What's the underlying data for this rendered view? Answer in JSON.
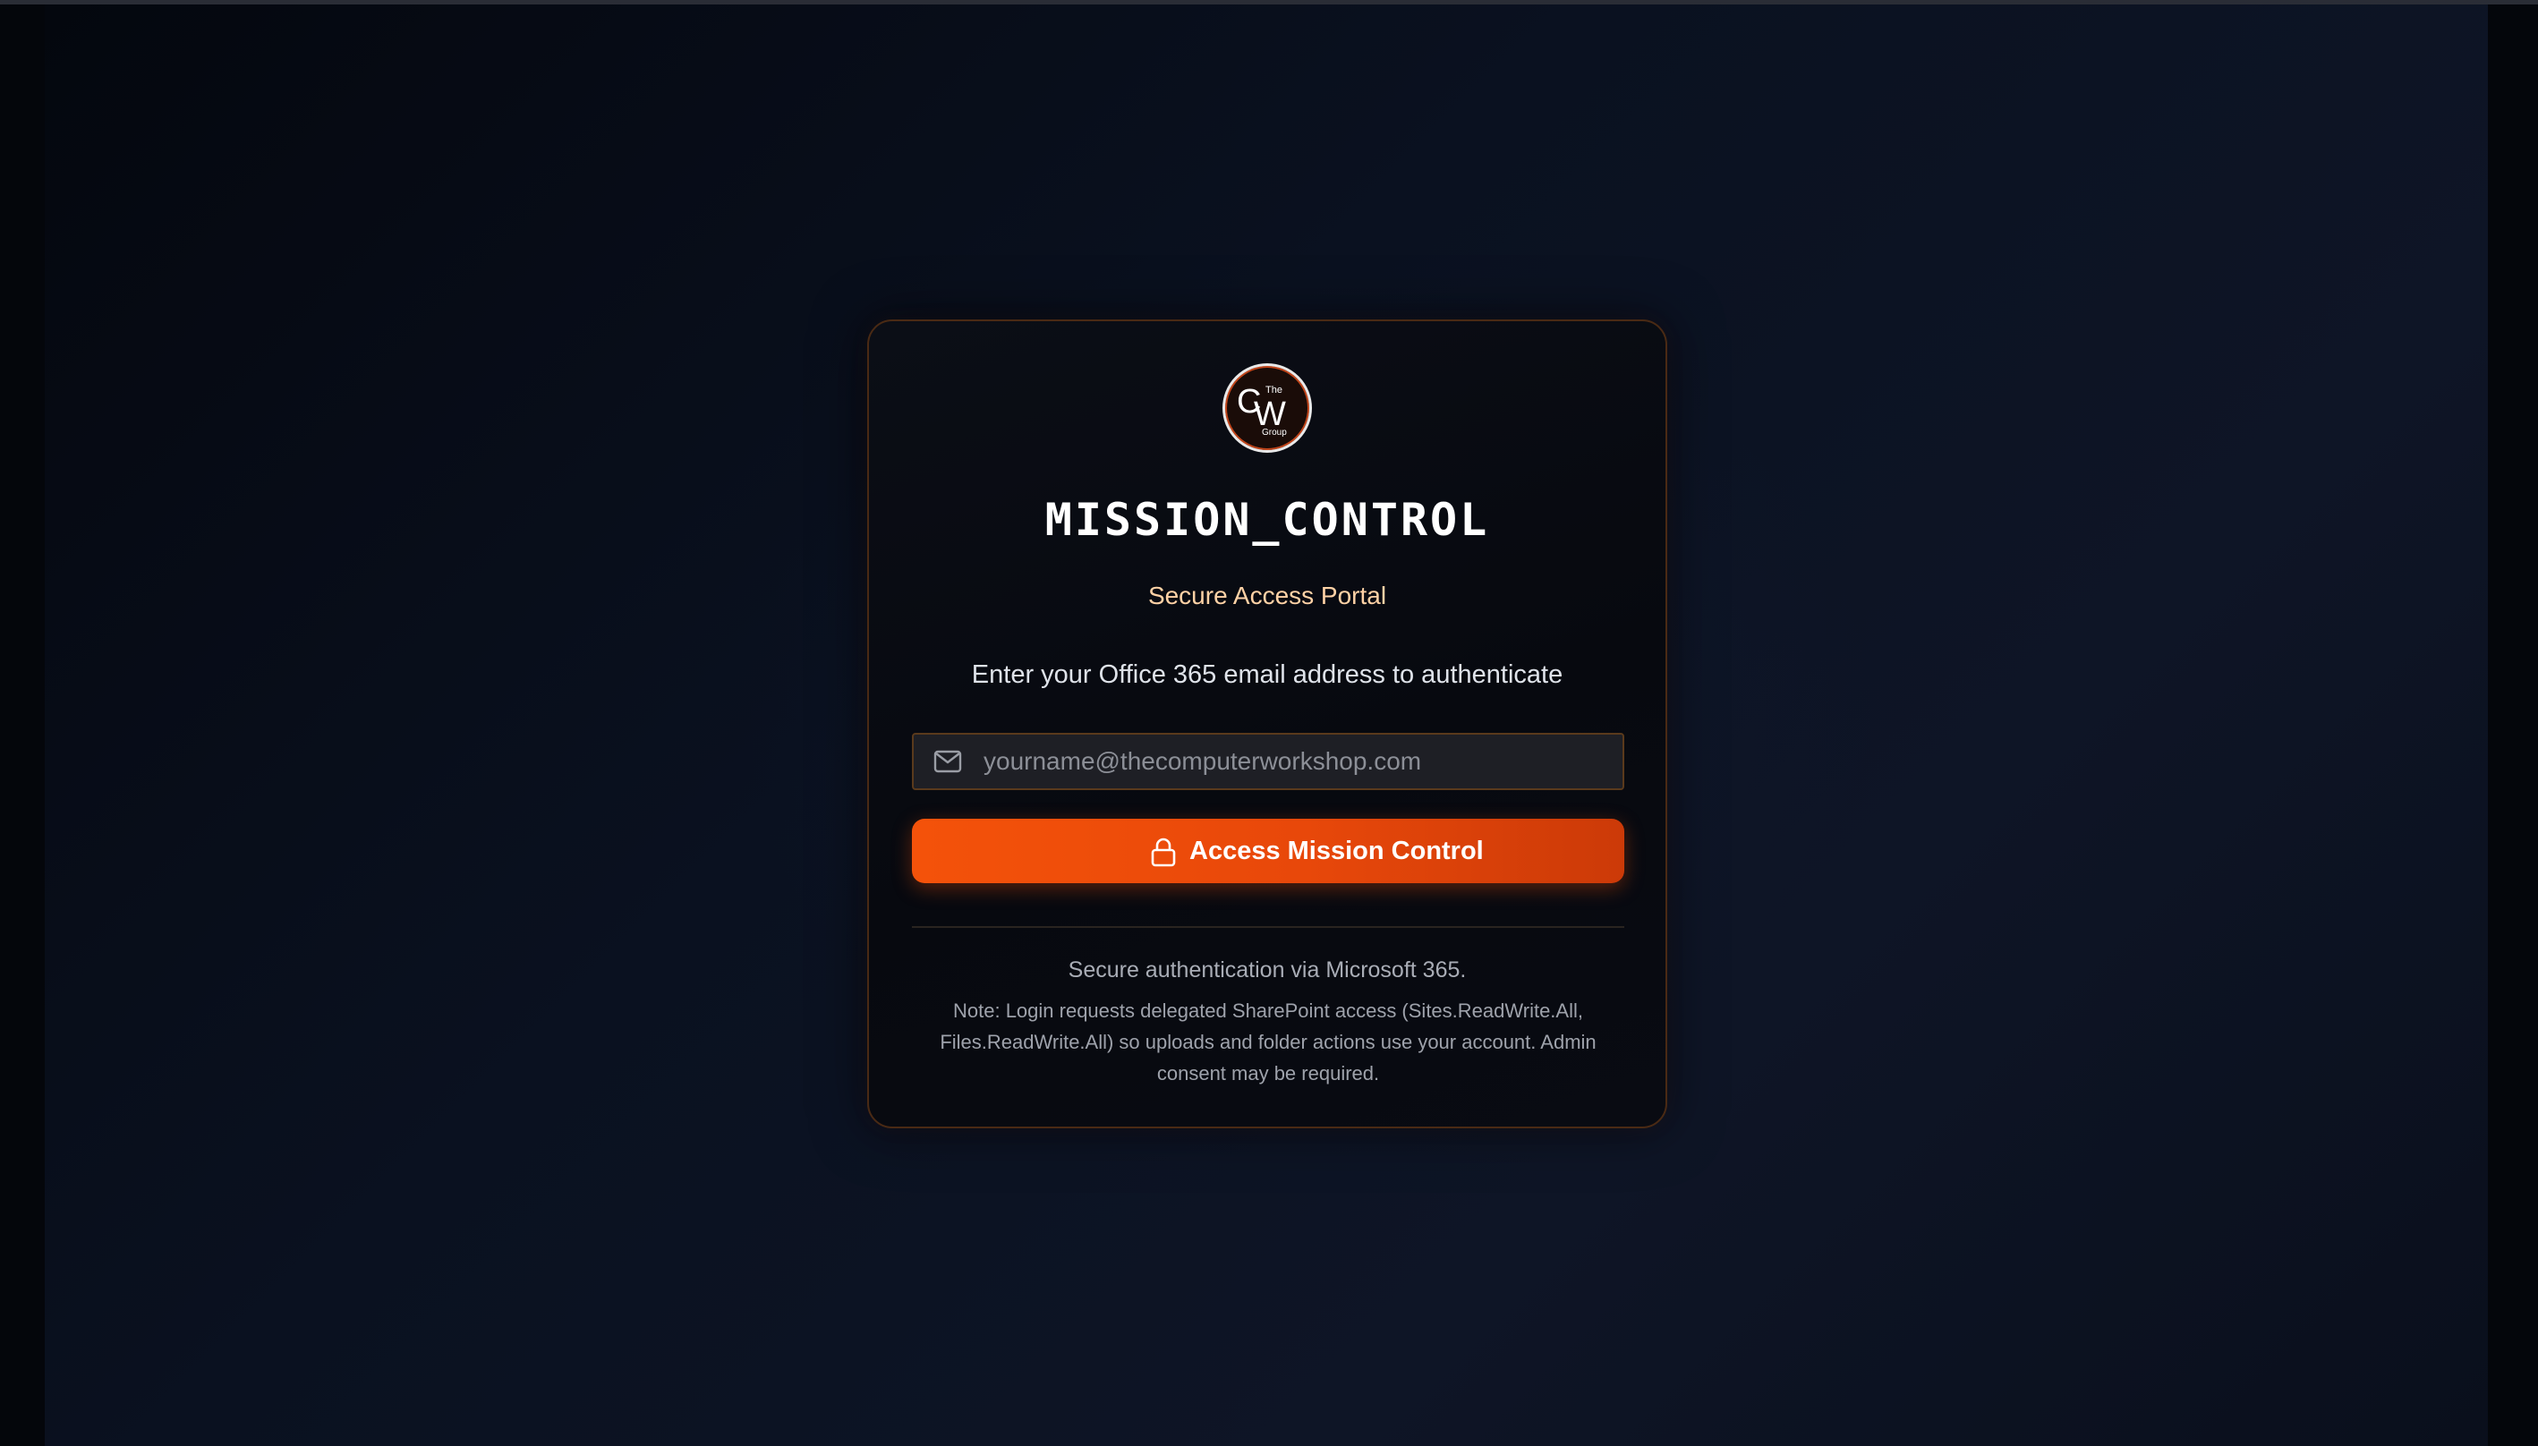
{
  "logo": {
    "initials": "CW",
    "top_text": "The",
    "bottom_text": "Group",
    "ring_color": "#e9e9e9",
    "accent_color": "#c2451a"
  },
  "login": {
    "title": "MISSION_CONTROL",
    "subtitle": "Secure Access Portal",
    "instruction": "Enter your Office 365 email address to authenticate",
    "email_placeholder": "yourname@thecomputerworkshop.com",
    "email_value": "",
    "email_icon": "mail-icon",
    "submit_label": "Access Mission Control",
    "submit_icon": "lock-icon",
    "footer_main": "Secure authentication via Microsoft 365.",
    "footer_note": "Note: Login requests delegated SharePoint access (Sites.ReadWrite.All, Files.ReadWrite.All) so uploads and folder actions use your account. Admin consent may be required."
  },
  "colors": {
    "accent": "#f4520a",
    "subtitle": "#ffd2a6",
    "background": "#0a1120"
  }
}
